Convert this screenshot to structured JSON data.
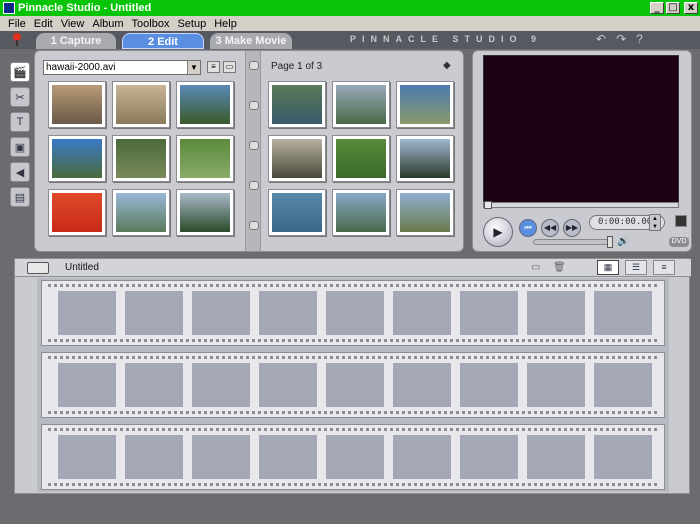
{
  "window": {
    "title": "Pinnacle Studio - Untitled",
    "controls": [
      "_",
      "□",
      "x"
    ]
  },
  "menu": [
    "File",
    "Edit",
    "View",
    "Album",
    "Toolbox",
    "Setup",
    "Help"
  ],
  "tabs": [
    {
      "label": "1 Capture"
    },
    {
      "label": "2 Edit"
    },
    {
      "label": "3 Make Movie"
    }
  ],
  "brand": "PINNACLE STUDIO 9",
  "top_icons": [
    "undo-icon",
    "redo-icon",
    "help-icon"
  ],
  "top_icon_glyphs": [
    "↶",
    "↷",
    "?"
  ],
  "left_tools": [
    {
      "icon": "video-scenes-icon",
      "glyph": "🎬"
    },
    {
      "icon": "transitions-icon",
      "glyph": "✂"
    },
    {
      "icon": "titles-icon",
      "glyph": "T"
    },
    {
      "icon": "photos-icon",
      "glyph": "▣"
    },
    {
      "icon": "sound-effects-icon",
      "glyph": "◀"
    },
    {
      "icon": "menus-icon",
      "glyph": "▤"
    }
  ],
  "album": {
    "file": "hawaii-2000.avi",
    "page_label": "Page 1 of 3",
    "left_thumbs": [
      {
        "colors": [
          "#b89a78",
          "#6a5a48"
        ]
      },
      {
        "colors": [
          "#c8b496",
          "#8a7a5c"
        ]
      },
      {
        "colors": [
          "#5a8ab8",
          "#3a5a2a"
        ]
      },
      {
        "colors": [
          "#3a7ac8",
          "#4a6a3a"
        ]
      },
      {
        "colors": [
          "#4a6a3a",
          "#7a8a5a"
        ]
      },
      {
        "colors": [
          "#5a8a3a",
          "#8aaa6a"
        ]
      },
      {
        "colors": [
          "#e04a2a",
          "#c82a1a"
        ]
      },
      {
        "colors": [
          "#9ab8d8",
          "#5a7a5a"
        ]
      },
      {
        "colors": [
          "#a8b8c8",
          "#2a4a2a"
        ]
      }
    ],
    "right_thumbs": [
      {
        "colors": [
          "#5a7a5a",
          "#3a5a6a"
        ]
      },
      {
        "colors": [
          "#98a8b8",
          "#4a6a4a"
        ]
      },
      {
        "colors": [
          "#4a7ab0",
          "#8a9a6a"
        ]
      },
      {
        "colors": [
          "#b8b0a0",
          "#4a4a3a"
        ]
      },
      {
        "colors": [
          "#5a8a3a",
          "#3a6a2a"
        ]
      },
      {
        "colors": [
          "#a0b8d0",
          "#2a3a2a"
        ]
      },
      {
        "colors": [
          "#5a88a8",
          "#3a6888"
        ]
      },
      {
        "colors": [
          "#88a8c8",
          "#4a6a4a"
        ]
      },
      {
        "colors": [
          "#90b0d0",
          "#6a7a4a"
        ]
      }
    ]
  },
  "player": {
    "timecode": "0:00:00.00"
  },
  "movie": {
    "title": "Untitled",
    "rows": 3,
    "frames_per_row": 9
  }
}
